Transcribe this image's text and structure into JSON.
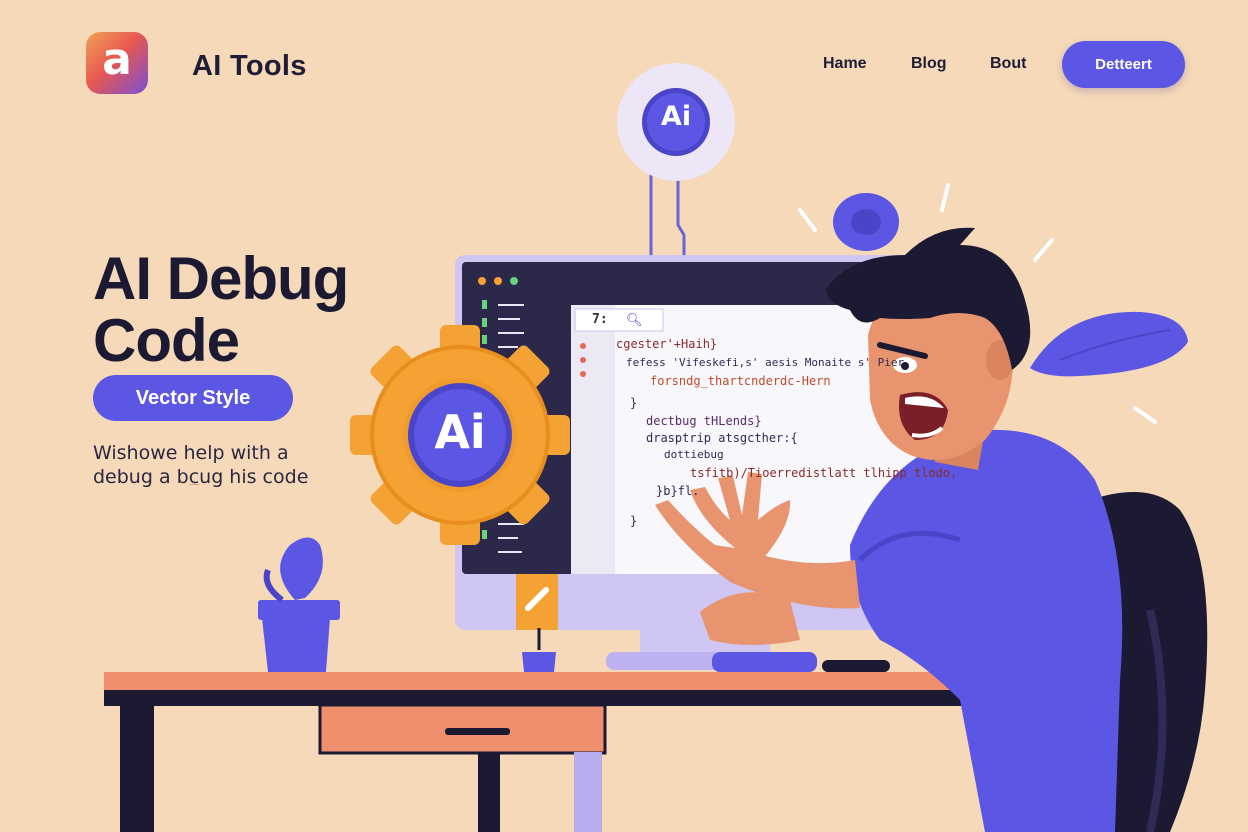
{
  "header": {
    "logo_letter": "a",
    "brand": "AI Tools",
    "nav": [
      "Hame",
      "Blog",
      "Bout"
    ],
    "cta_label": "Detteert"
  },
  "hero": {
    "headline_line1": "AI Debug",
    "headline_line2": "Code",
    "pill_label": "Vector Style",
    "sub_line1": "Wishowe help with a",
    "sub_line2_a": "debug a b",
    "sub_line2_u": "c",
    "sub_line2_b": "ug his code"
  },
  "badge_top": "Ai",
  "gear_badge": "Ai",
  "editor": {
    "tab_text": "7:",
    "lines": [
      "cgester'+Haih}",
      "fefess 'Vifeskefi,s' aesis Monaite s' Pier",
      "forsndg_thartcnderdc-Hern",
      "}",
      "dectbug  tHLends}",
      "drasptrip atsgcther:{",
      "dottiebug",
      "tsfitb)/Tioerredistlatt tlhipp  tlodo,",
      "}b}fl.",
      "}"
    ]
  },
  "colors": {
    "background": "#f5d9b8",
    "accent": "#5b56e3",
    "gear": "#f4a233",
    "desk_top": "#ef8f6e",
    "dark": "#1c1a33"
  }
}
